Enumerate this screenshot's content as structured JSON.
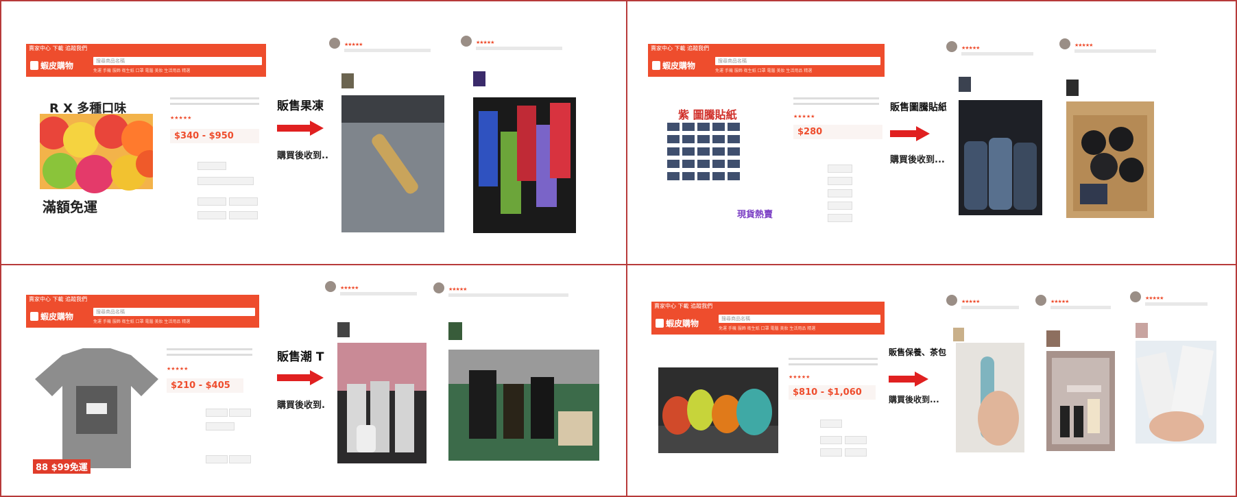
{
  "colors": {
    "shopee": "#ee4d2d",
    "border": "#b73a3a",
    "arrow": "#e02020"
  },
  "panels": [
    {
      "product_text": "R X 多種口味",
      "promo": "滿額免運",
      "price": "$340 - $950",
      "sell_label": "販售果凍",
      "recv_label": "購買後收到..."
    },
    {
      "product_text": "紫 圖騰貼紙",
      "promo": "現貨熱賣",
      "price": "$280",
      "sell_label": "販售圖騰貼紙",
      "recv_label": "購買後收到..."
    },
    {
      "product_text": "",
      "promo": "88 $99免運",
      "price": "$210 - $405",
      "sell_label": "販售潮 T",
      "recv_label": "購買後收到..."
    },
    {
      "product_text": "",
      "promo": "",
      "price": "$810 - $1,060",
      "sell_label": "販售保養、茶包",
      "recv_label": "購買後收到..."
    }
  ],
  "shop": {
    "logo": "蝦皮購物",
    "topbar": "賣家中心 下載 追蹤我們",
    "search": "搜尋商品名稱",
    "cats": "免運 手機 服飾 衛生紙 口罩 電腦 美妝 生活用品 精選"
  },
  "icons": [
    "shopping-bag-icon",
    "star-icon",
    "arrow-right-icon"
  ]
}
